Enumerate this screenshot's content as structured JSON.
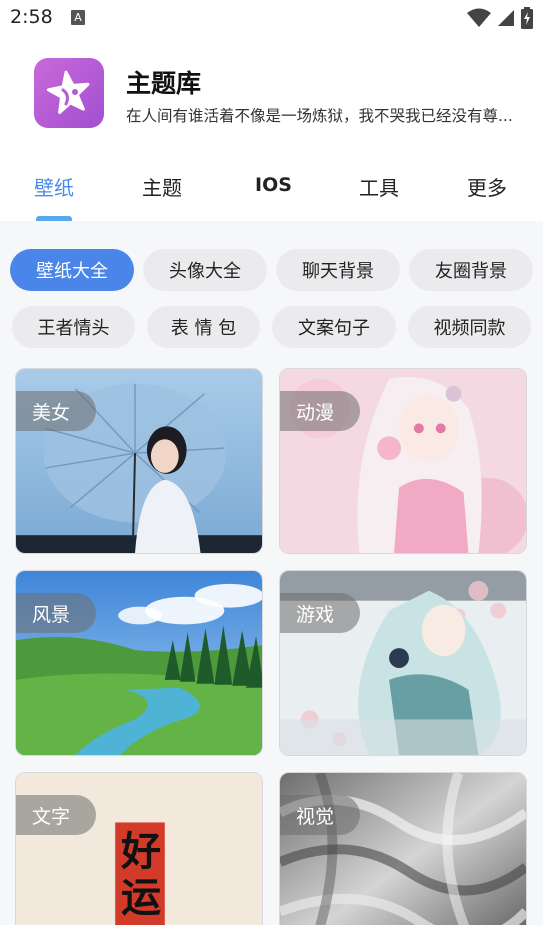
{
  "status_bar": {
    "time": "2:58",
    "notification_letter": "A"
  },
  "app": {
    "title": "主题库",
    "subtitle": "在人间有谁活着不像是一场炼狱，我不哭我已经没有尊..."
  },
  "tabs": [
    {
      "label": "壁纸",
      "active": true
    },
    {
      "label": "主题",
      "active": false
    },
    {
      "label": "IOS",
      "active": false
    },
    {
      "label": "工具",
      "active": false
    },
    {
      "label": "更多",
      "active": false
    }
  ],
  "chips": [
    {
      "label": "壁纸大全",
      "active": true
    },
    {
      "label": "头像大全",
      "active": false
    },
    {
      "label": "聊天背景",
      "active": false
    },
    {
      "label": "友圈背景",
      "active": false
    },
    {
      "label": "王者情头",
      "active": false
    },
    {
      "label": "表 情 包",
      "active": false
    },
    {
      "label": "文案句子",
      "active": false
    },
    {
      "label": "视频同款",
      "active": false
    }
  ],
  "categories": [
    {
      "label": "美女",
      "image": "woman-with-umbrella"
    },
    {
      "label": "动漫",
      "image": "anime-girl-pink"
    },
    {
      "label": "风景",
      "image": "meadow-river-landscape"
    },
    {
      "label": "游戏",
      "image": "game-character-art"
    },
    {
      "label": "文字",
      "image": "calligraphy-text-card",
      "art_text": "好运"
    },
    {
      "label": "视觉",
      "image": "abstract-silver-waves"
    }
  ],
  "colors": {
    "accent": "#4a86ea",
    "tab_active": "#4a8be8",
    "chip_bg": "#ebebed",
    "app_icon": "#b85ad6"
  }
}
